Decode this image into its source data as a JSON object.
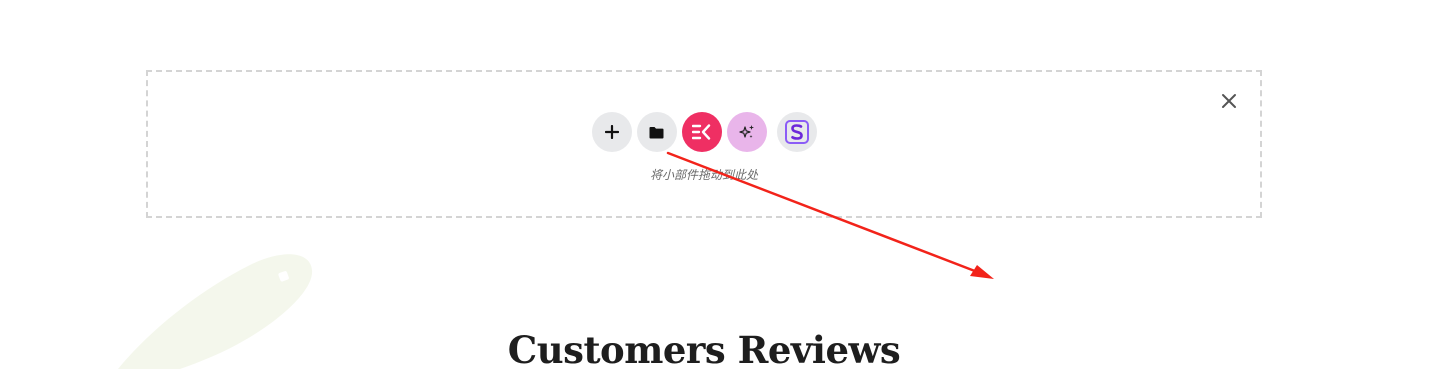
{
  "drop_zone": {
    "hint": "将小部件拖动到此处",
    "buttons": [
      {
        "name": "add-section-button",
        "icon": "plus-icon"
      },
      {
        "name": "template-library-button",
        "icon": "folder-icon"
      },
      {
        "name": "elementskit-button",
        "icon": "ek-logo-icon"
      },
      {
        "name": "ai-button",
        "icon": "sparkles-icon"
      },
      {
        "name": "s-plugin-button",
        "icon": "s-logo-icon"
      }
    ],
    "close_icon": "close-icon"
  },
  "section": {
    "title": "Customers Reviews"
  },
  "colors": {
    "ek_brand": "#ef2f63",
    "ai_brand": "#e9b5ea",
    "s_brand": "#8b5cf6",
    "arrow": "#f2231a",
    "button_bg": "#e8e9eb"
  }
}
